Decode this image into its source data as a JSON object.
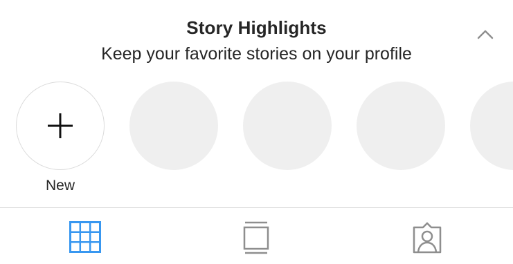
{
  "story_highlights": {
    "title": "Story Highlights",
    "subtitle": "Keep your favorite stories on your profile",
    "collapse_icon": "chevron-up-icon",
    "new_label": "New",
    "new_icon": "plus-icon",
    "placeholder_count": 4
  },
  "tabs": [
    {
      "icon": "grid-icon",
      "active": true
    },
    {
      "icon": "feed-icon",
      "active": false
    },
    {
      "icon": "tagged-icon",
      "active": false
    }
  ],
  "colors": {
    "text": "#262626",
    "active_tab": "#3897f0",
    "inactive_tab": "#8e8e8e",
    "placeholder": "#efefef",
    "border": "#dbdbdb"
  }
}
